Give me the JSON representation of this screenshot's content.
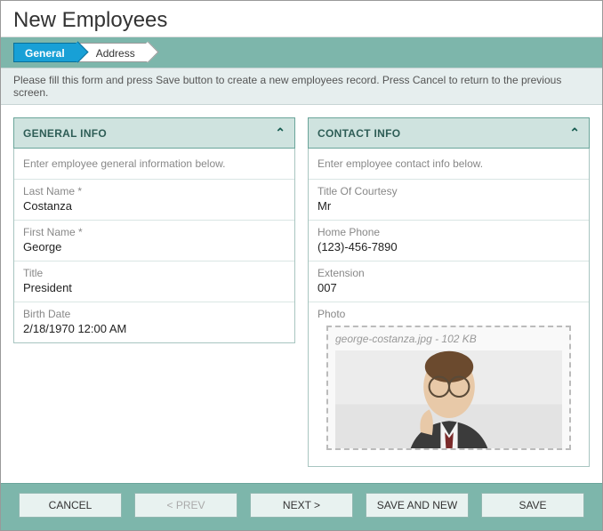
{
  "header": {
    "title": "New Employees"
  },
  "tabs": {
    "items": [
      {
        "label": "General"
      },
      {
        "label": "Address"
      }
    ]
  },
  "instruction": "Please fill this form and press Save button to create a new employees record. Press Cancel to return to the previous screen.",
  "panels": {
    "general": {
      "title": "GENERAL INFO",
      "hint": "Enter employee general information below.",
      "fields": {
        "last_name": {
          "label": "Last Name *",
          "value": "Costanza"
        },
        "first_name": {
          "label": "First Name *",
          "value": "George"
        },
        "title": {
          "label": "Title",
          "value": "President"
        },
        "birth_date": {
          "label": "Birth Date",
          "value": "2/18/1970 12:00 AM"
        }
      }
    },
    "contact": {
      "title": "CONTACT INFO",
      "hint": "Enter employee contact info below.",
      "fields": {
        "courtesy": {
          "label": "Title Of Courtesy",
          "value": "Mr"
        },
        "home_phone": {
          "label": "Home Phone",
          "value": "(123)-456-7890"
        },
        "extension": {
          "label": "Extension",
          "value": "007"
        },
        "photo": {
          "label": "Photo",
          "caption": "george-costanza.jpg - 102 KB"
        }
      }
    }
  },
  "footer": {
    "cancel": "CANCEL",
    "prev": "< PREV",
    "next": "NEXT >",
    "save_new": "SAVE AND NEW",
    "save": "SAVE"
  }
}
